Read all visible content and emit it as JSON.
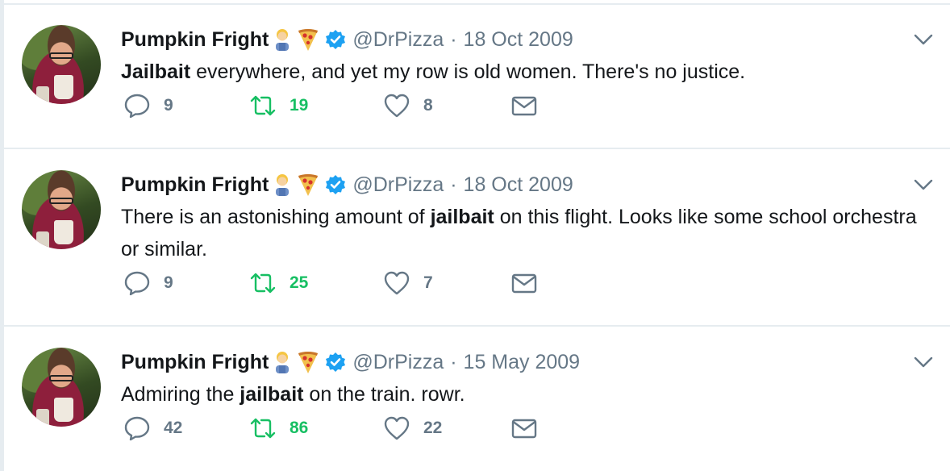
{
  "tweets": [
    {
      "name": "Pumpkin Fright",
      "handle": "@DrPizza",
      "dot": "·",
      "date": "18 Oct 2009",
      "text_parts": [
        {
          "t": "Jailbait",
          "b": true
        },
        {
          "t": " everywhere, and yet my row is old women. There's no justice.",
          "b": false
        }
      ],
      "replies": "9",
      "retweets": "19",
      "likes": "8"
    },
    {
      "name": "Pumpkin Fright",
      "handle": "@DrPizza",
      "dot": "·",
      "date": "18 Oct 2009",
      "text_parts": [
        {
          "t": "There is an astonishing amount of ",
          "b": false
        },
        {
          "t": "jailbait",
          "b": true
        },
        {
          "t": " on this flight. Looks like some school orchestra or similar.",
          "b": false
        }
      ],
      "replies": "9",
      "retweets": "25",
      "likes": "7"
    },
    {
      "name": "Pumpkin Fright",
      "handle": "@DrPizza",
      "dot": "·",
      "date": "15 May 2009",
      "text_parts": [
        {
          "t": "Admiring the ",
          "b": false
        },
        {
          "t": "jailbait",
          "b": true
        },
        {
          "t": " on the train. rowr.",
          "b": false
        }
      ],
      "replies": "42",
      "retweets": "86",
      "likes": "22"
    }
  ],
  "icons": {
    "emoji_1": "man-farmer-emoji-icon",
    "emoji_2": "pizza-emoji-icon",
    "verified": "verified-badge-icon",
    "reply": "reply-icon",
    "retweet": "retweet-icon",
    "like": "heart-icon",
    "dm": "envelope-icon",
    "menu": "chevron-down-icon"
  },
  "colors": {
    "text": "#14171a",
    "muted": "#657786",
    "retweet": "#17bf63",
    "verified": "#1da1f2",
    "divider": "#e6ecf0"
  }
}
